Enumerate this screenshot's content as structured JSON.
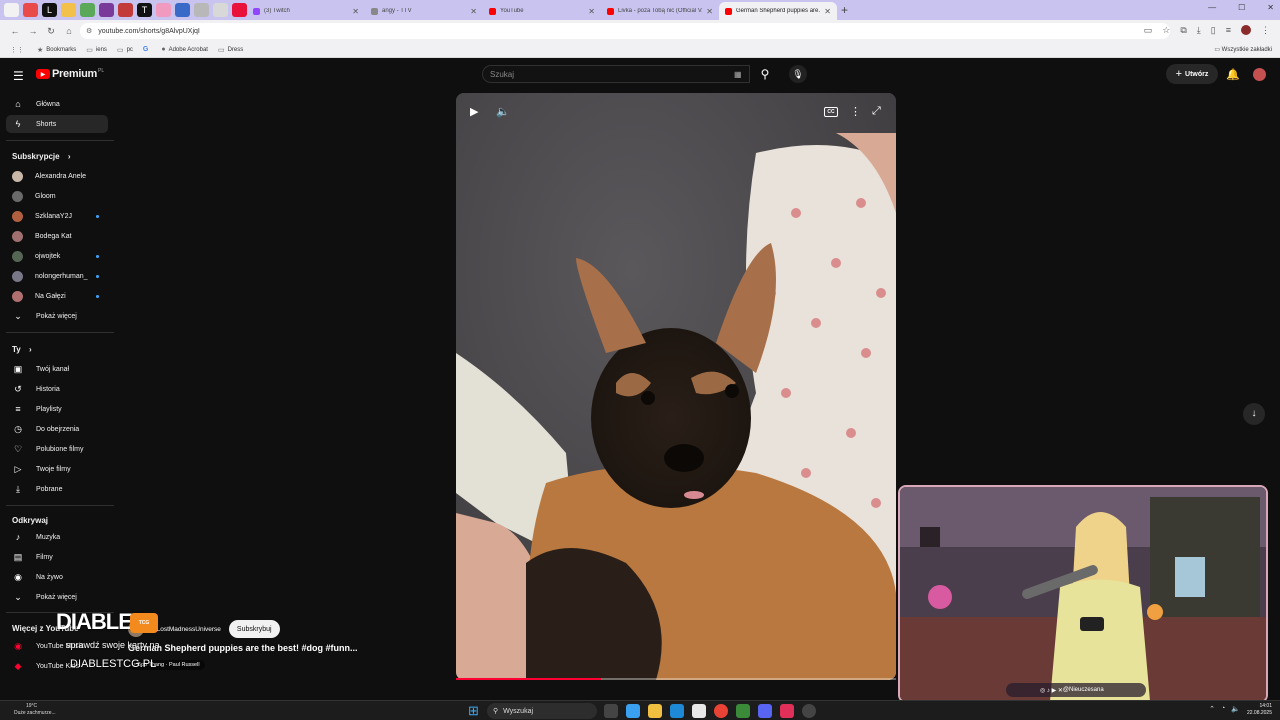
{
  "browser": {
    "tabs": [
      {
        "title": "(3) Twitch",
        "color": "#9146ff"
      },
      {
        "title": "angy - TTV",
        "color": "#888888"
      },
      {
        "title": "YouTube",
        "color": "#ff0000"
      },
      {
        "title": "Livka - poza Tobą nic (Official V...",
        "color": "#ff0000"
      },
      {
        "title": "German Shepherd puppies are...",
        "color": "#ff0000",
        "active": true
      }
    ],
    "url": "youtube.com/shorts/g8AlvpUXjqI",
    "bookmarks": [
      {
        "label": "Bookmarks",
        "icon": "star-icon"
      },
      {
        "label": "iens",
        "icon": "folder-icon"
      },
      {
        "label": "pc",
        "icon": "folder-icon"
      },
      {
        "label": "G",
        "icon": "google-icon"
      },
      {
        "label": "Adobe Acrobat",
        "icon": "acrobat-icon"
      },
      {
        "label": "Dress",
        "icon": "folder-icon"
      }
    ],
    "all_bookmarks": "Wszystkie zakładki"
  },
  "header": {
    "logo_text": "Premium",
    "logo_country": "PL",
    "search_placeholder": "Szukaj",
    "create_label": "Utwórz"
  },
  "sidebar": {
    "main": [
      {
        "label": "Główna",
        "icon": "home-icon"
      },
      {
        "label": "Shorts",
        "icon": "shorts-icon",
        "active": true
      }
    ],
    "subs_heading": "Subskrypcje",
    "subs": [
      {
        "label": "Alexandra Anele",
        "color": "#c9b8a8",
        "dot": false
      },
      {
        "label": "Gloom",
        "color": "#6a6a6a",
        "dot": false
      },
      {
        "label": "SzklanaY2J",
        "color": "#b06040",
        "dot": true
      },
      {
        "label": "Bodega Kat",
        "color": "#a07070",
        "dot": false
      },
      {
        "label": "ojwojtek",
        "color": "#556655",
        "dot": true
      },
      {
        "label": "nolongerhuman_",
        "color": "#777788",
        "dot": true
      },
      {
        "label": "Na Gałęzi",
        "color": "#b07070",
        "dot": true
      }
    ],
    "more_label": "Pokaż więcej",
    "you_heading": "Ty",
    "you": [
      {
        "label": "Twój kanał",
        "icon": "channel-icon"
      },
      {
        "label": "Historia",
        "icon": "history-icon"
      },
      {
        "label": "Playlisty",
        "icon": "playlist-icon"
      },
      {
        "label": "Do obejrzenia",
        "icon": "watch-later-icon"
      },
      {
        "label": "Polubione filmy",
        "icon": "like-icon"
      },
      {
        "label": "Twoje filmy",
        "icon": "your-videos-icon"
      },
      {
        "label": "Pobrane",
        "icon": "download-icon"
      }
    ],
    "explore_heading": "Odkrywaj",
    "explore": [
      {
        "label": "Muzyka",
        "icon": "music-icon"
      },
      {
        "label": "Filmy",
        "icon": "movies-icon"
      },
      {
        "label": "Na żywo",
        "icon": "live-icon"
      }
    ],
    "explore_more": "Pokaż więcej",
    "more_yt_heading": "Więcej z YouTube",
    "more_yt": [
      {
        "label": "YouTube Music"
      },
      {
        "label": "YouTube Kids"
      }
    ]
  },
  "short": {
    "channel": "@LostMadnessUniverse",
    "subscribe_label": "Subskrybuj",
    "title": "German Shepherd puppies are the best! #dog #funn...",
    "music": "Boo Thang · Paul Russell",
    "progress": 0.33
  },
  "overlay": {
    "brand": "DIABLES",
    "badge": "TCG",
    "subtitle": "sprawdź swoje karty na",
    "url": "DIABLESTCG.PL",
    "socials": "@Nieuczesana"
  },
  "taskbar": {
    "temp": "19°C",
    "weather": "Duże zachmurze...",
    "search": "Wyszukaj",
    "time": "14:01",
    "date": "22.08.2025"
  }
}
